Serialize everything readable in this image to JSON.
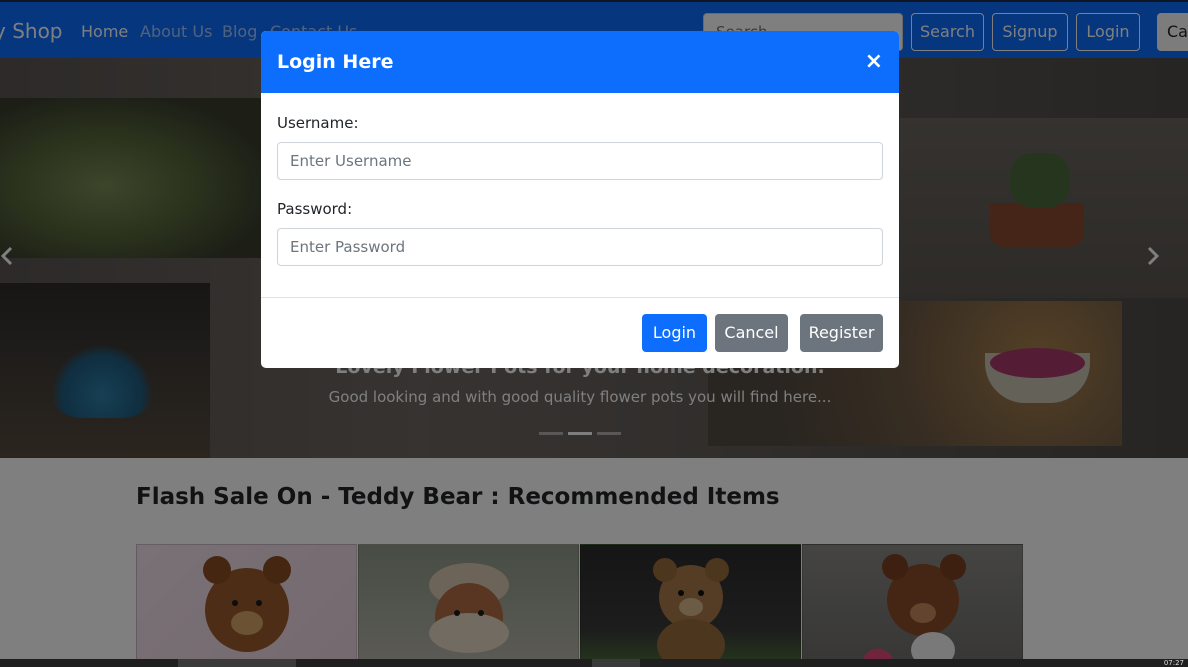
{
  "navbar": {
    "brand": "y Shop",
    "links": [
      "Home",
      "About Us",
      "Blog",
      "Contact Us"
    ],
    "search_placeholder": "Search",
    "search_button": "Search",
    "signup_button": "Signup",
    "login_button": "Login",
    "cart_button": "Cart"
  },
  "carousel": {
    "caption_title": "Lovely Flower Pots for your home decoration.",
    "caption_text": "Good looking and with good quality flower pots you will find here...",
    "prev_icon": "chevron-left-icon",
    "next_icon": "chevron-right-icon",
    "active_slide": 2,
    "slide_count": 3
  },
  "main": {
    "section_title": "Flash Sale On - Teddy Bear : Recommended Items",
    "cards": [
      {
        "image": "teddy-bear-pink"
      },
      {
        "image": "teddy-bear-knit-hat"
      },
      {
        "image": "teddy-bear-dark"
      },
      {
        "image": "teddy-bear-heart"
      }
    ]
  },
  "modal": {
    "title": "Login Here",
    "close_symbol": "×",
    "username_label": "Username:",
    "username_placeholder": "Enter Username",
    "username_value": "",
    "password_label": "Password:",
    "password_placeholder": "Enter Password",
    "password_value": "",
    "login_button": "Login",
    "cancel_button": "Cancel",
    "register_button": "Register"
  },
  "taskbar": {
    "time": "07:27"
  },
  "colors": {
    "primary": "#0d6efd",
    "secondary": "#6c757d",
    "backdrop": "rgba(0,0,0,0.5)"
  }
}
